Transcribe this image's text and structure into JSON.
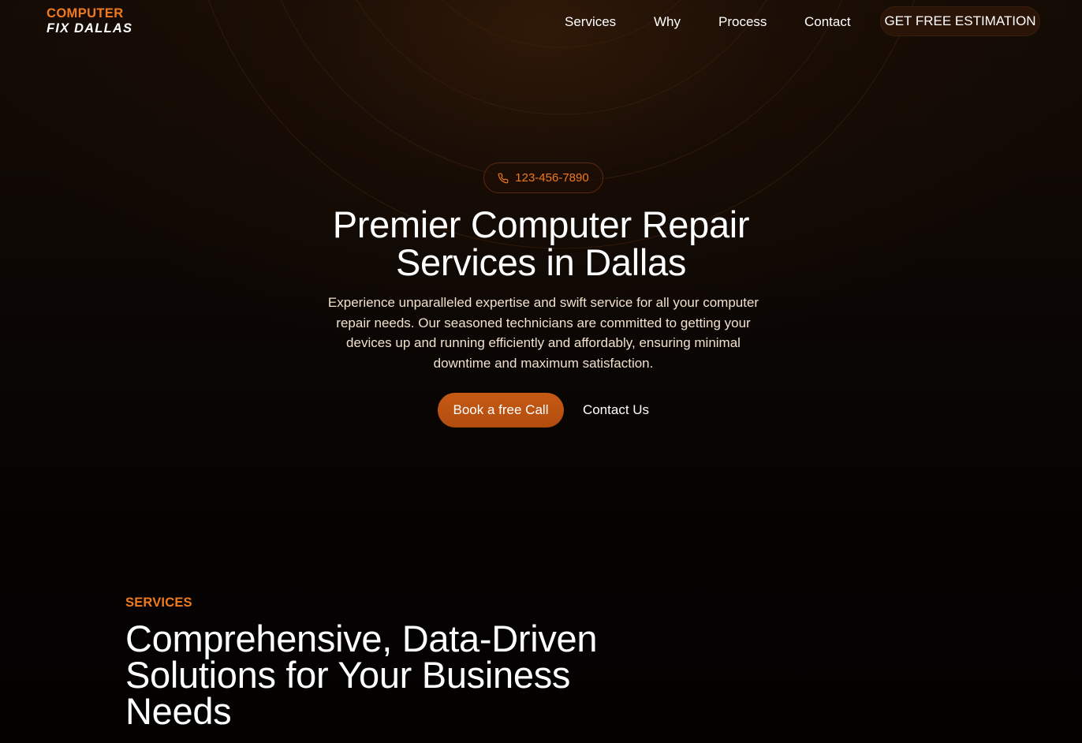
{
  "logo": {
    "line1": "COMPUTER",
    "line2": "FIX DALLAS"
  },
  "nav": {
    "items": [
      {
        "label": "Services"
      },
      {
        "label": "Why"
      },
      {
        "label": "Process"
      },
      {
        "label": "Contact"
      }
    ],
    "cta_label": "GET FREE ESTIMATION"
  },
  "hero": {
    "phone": "123-456-7890",
    "phone_icon": "phone-icon",
    "title_line1": "Premier Computer Repair",
    "title_line2": "Services in Dallas",
    "description": "Experience unparalleled expertise and swift service for all your computer repair needs. Our seasoned technicians are committed to getting your devices up and running efficiently and affordably, ensuring minimal downtime and maximum satisfaction.",
    "primary_button": "Book a free Call",
    "secondary_button": "Contact Us"
  },
  "services": {
    "label": "SERVICES",
    "title_line1": "Comprehensive, Data-Driven",
    "title_line2": "Solutions for Your Business",
    "title_line3": "Needs"
  },
  "colors": {
    "accent": "#f07a1e",
    "button": "#c55a14",
    "background": "#050302"
  }
}
